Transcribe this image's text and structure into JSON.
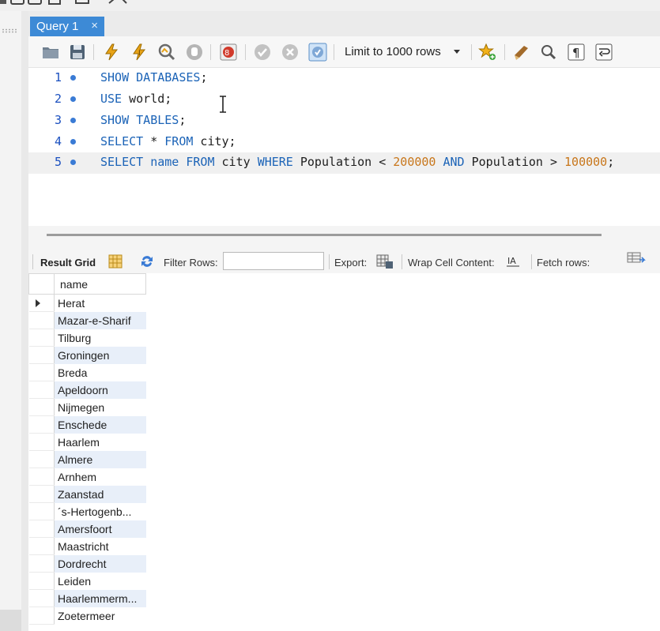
{
  "tab": {
    "title": "Query 1",
    "close": "×"
  },
  "toolbar": {
    "icons": [
      "folder-open-icon",
      "save-icon",
      "execute-icon",
      "execute-current-icon",
      "explain-icon",
      "stop-icon",
      "toggle-continue-icon",
      "commit-icon",
      "rollback-icon",
      "autocommit-icon",
      "add-snippet-icon",
      "beautify-icon",
      "find-icon",
      "invisible-chars-icon",
      "wrap-lines-icon"
    ],
    "limit_label": "Limit to 1000 rows"
  },
  "editor": {
    "lines": [
      {
        "no": "1",
        "tokens": [
          {
            "t": "SHOW DATABASES",
            "c": "kw"
          },
          {
            "t": ";",
            "c": ""
          }
        ]
      },
      {
        "no": "2",
        "tokens": [
          {
            "t": "USE",
            "c": "kw"
          },
          {
            "t": " world;",
            "c": ""
          }
        ]
      },
      {
        "no": "3",
        "tokens": [
          {
            "t": "SHOW TABLES",
            "c": "kw"
          },
          {
            "t": ";",
            "c": ""
          }
        ]
      },
      {
        "no": "4",
        "tokens": [
          {
            "t": "SELECT",
            "c": "kw"
          },
          {
            "t": " * ",
            "c": ""
          },
          {
            "t": "FROM",
            "c": "kw"
          },
          {
            "t": " city;",
            "c": ""
          }
        ]
      },
      {
        "no": "5",
        "tokens": [
          {
            "t": "SELECT",
            "c": "kw"
          },
          {
            "t": " ",
            "c": ""
          },
          {
            "t": "name",
            "c": "kw"
          },
          {
            "t": " ",
            "c": ""
          },
          {
            "t": "FROM",
            "c": "kw"
          },
          {
            "t": " city ",
            "c": ""
          },
          {
            "t": "WHERE",
            "c": "kw"
          },
          {
            "t": " Population < ",
            "c": ""
          },
          {
            "t": "200000",
            "c": "num"
          },
          {
            "t": " ",
            "c": ""
          },
          {
            "t": "AND",
            "c": "kw"
          },
          {
            "t": " Population > ",
            "c": ""
          },
          {
            "t": "100000",
            "c": "num"
          },
          {
            "t": ";",
            "c": ""
          }
        ]
      }
    ]
  },
  "result_toolbar": {
    "result_grid": "Result Grid",
    "filter_rows": "Filter Rows:",
    "filter_value": "",
    "export": "Export:",
    "wrap_cell": "Wrap Cell Content:",
    "fetch_rows": "Fetch rows:"
  },
  "grid": {
    "column": "name",
    "rows": [
      "Herat",
      "Mazar-e-Sharif",
      "Tilburg",
      "Groningen",
      "Breda",
      "Apeldoorn",
      "Nijmegen",
      "Enschede",
      "Haarlem",
      "Almere",
      "Arnhem",
      "Zaanstad",
      "´s-Hertogenb...",
      "Amersfoort",
      "Maastricht",
      "Dordrecht",
      "Leiden",
      "Haarlemmerm...",
      "Zoetermeer"
    ]
  }
}
